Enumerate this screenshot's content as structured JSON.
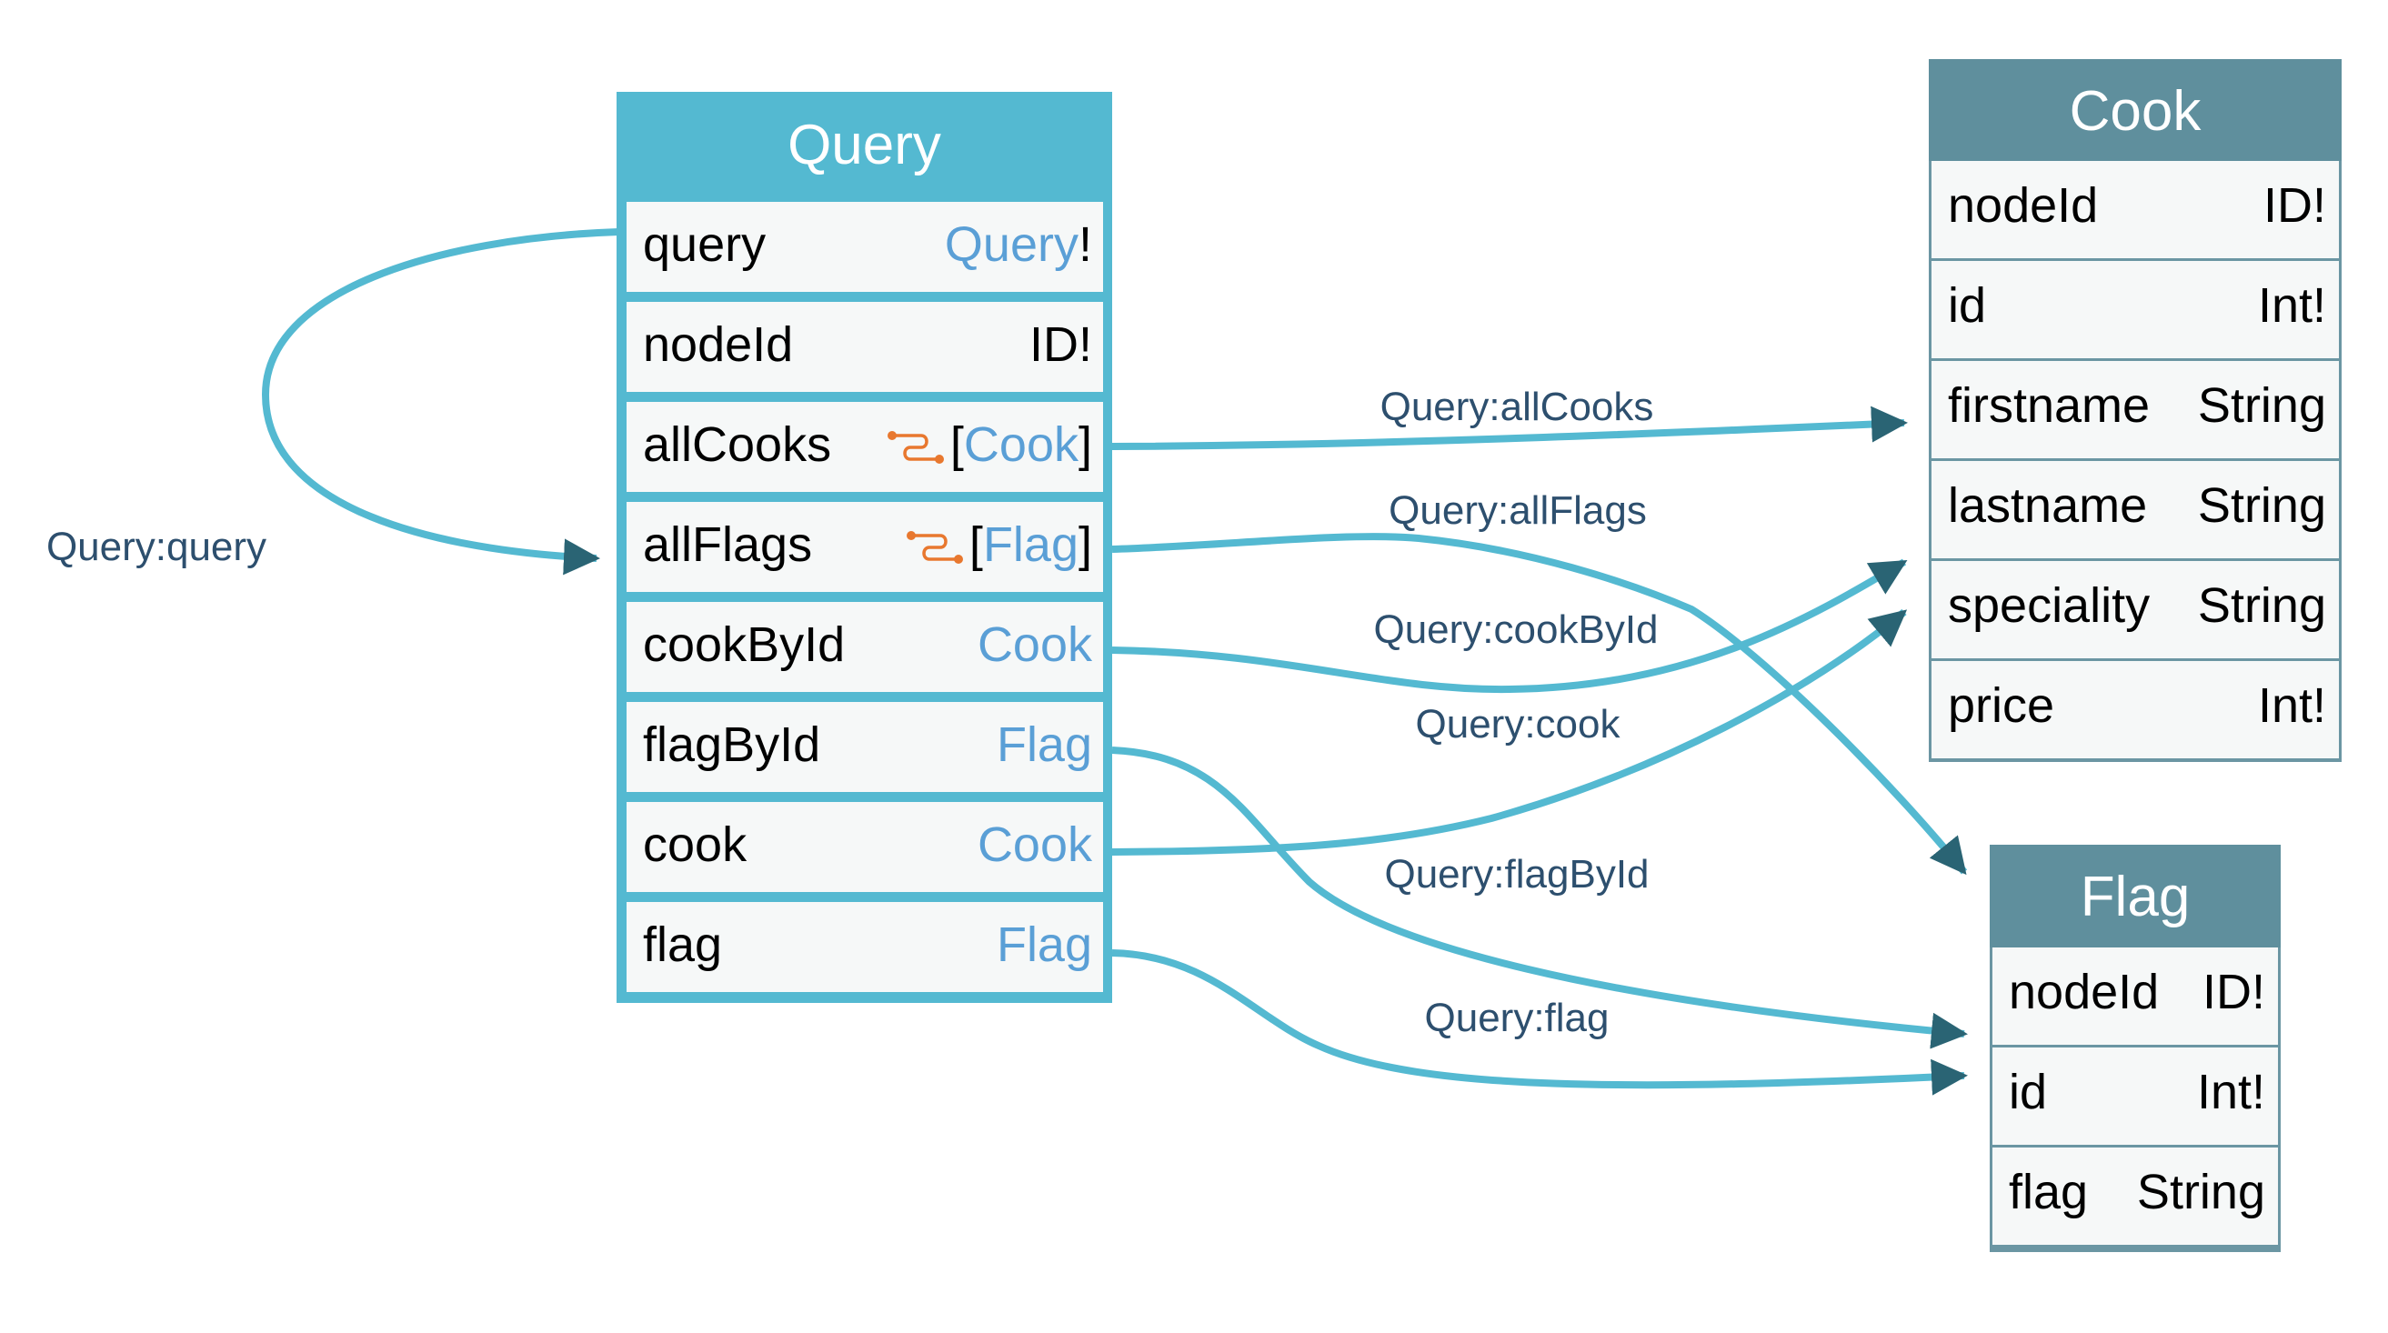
{
  "colors": {
    "query_node": "#54B9D1",
    "entity_header": "#5F8F9D",
    "entity_border": "#6B96A3",
    "row_bg": "#F6F8F8",
    "edge": "#54B9D1",
    "arrowhead": "#2A6474",
    "edge_label": "#2D4F6E",
    "type_link": "#5A9FD6",
    "connection_icon": "#E8782F"
  },
  "nodes": {
    "query": {
      "title": "Query",
      "fields": [
        {
          "name": "query",
          "type": "Query",
          "suffix": "!",
          "prefix": "",
          "link": true,
          "connection": false
        },
        {
          "name": "nodeId",
          "type": "ID!",
          "suffix": "",
          "prefix": "",
          "link": false,
          "connection": false
        },
        {
          "name": "allCooks",
          "type": "Cook",
          "suffix": "]",
          "prefix": "[",
          "link": true,
          "connection": true
        },
        {
          "name": "allFlags",
          "type": "Flag",
          "suffix": "]",
          "prefix": "[",
          "link": true,
          "connection": true
        },
        {
          "name": "cookById",
          "type": "Cook",
          "suffix": "",
          "prefix": "",
          "link": true,
          "connection": false
        },
        {
          "name": "flagById",
          "type": "Flag",
          "suffix": "",
          "prefix": "",
          "link": true,
          "connection": false
        },
        {
          "name": "cook",
          "type": "Cook",
          "suffix": "",
          "prefix": "",
          "link": true,
          "connection": false
        },
        {
          "name": "flag",
          "type": "Flag",
          "suffix": "",
          "prefix": "",
          "link": true,
          "connection": false
        }
      ]
    },
    "cook": {
      "title": "Cook",
      "fields": [
        {
          "name": "nodeId",
          "type": "ID!"
        },
        {
          "name": "id",
          "type": "Int!"
        },
        {
          "name": "firstname",
          "type": "String"
        },
        {
          "name": "lastname",
          "type": "String"
        },
        {
          "name": "speciality",
          "type": "String"
        },
        {
          "name": "price",
          "type": "Int!"
        }
      ]
    },
    "flag": {
      "title": "Flag",
      "fields": [
        {
          "name": "nodeId",
          "type": "ID!"
        },
        {
          "name": "id",
          "type": "Int!"
        },
        {
          "name": "flag",
          "type": "String"
        }
      ]
    }
  },
  "edges": [
    {
      "label": "Query:query",
      "from": "Query.query",
      "to": "Query"
    },
    {
      "label": "Query:allCooks",
      "from": "Query.allCooks",
      "to": "Cook"
    },
    {
      "label": "Query:allFlags",
      "from": "Query.allFlags",
      "to": "Flag"
    },
    {
      "label": "Query:cookById",
      "from": "Query.cookById",
      "to": "Cook"
    },
    {
      "label": "Query:cook",
      "from": "Query.cook",
      "to": "Cook"
    },
    {
      "label": "Query:flagById",
      "from": "Query.flagById",
      "to": "Flag"
    },
    {
      "label": "Query:flag",
      "from": "Query.flag",
      "to": "Flag"
    }
  ]
}
